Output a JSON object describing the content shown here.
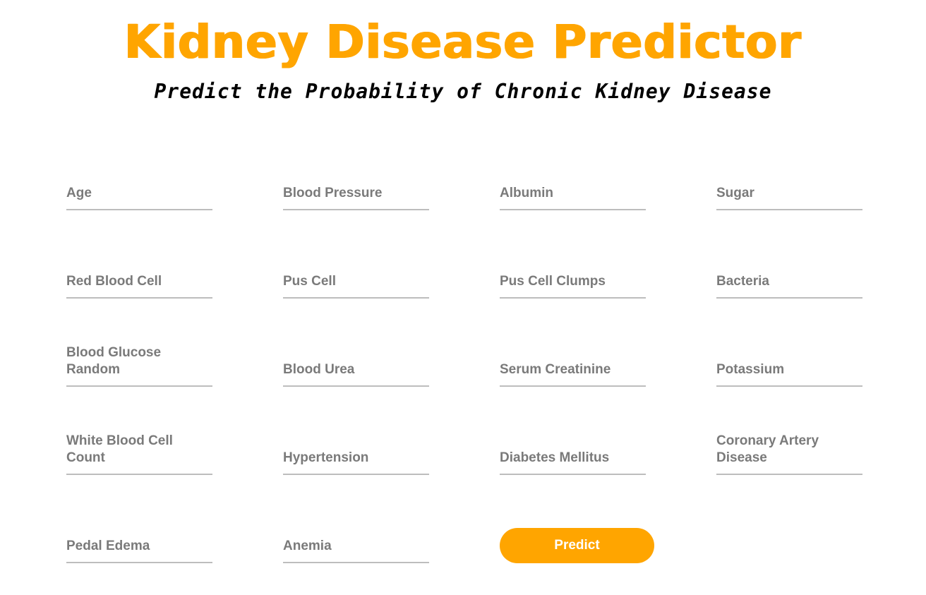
{
  "header": {
    "title": "Kidney Disease Predictor",
    "subtitle": "Predict the Probability of Chronic Kidney Disease"
  },
  "form": {
    "fields": [
      {
        "label": "Age"
      },
      {
        "label": "Blood Pressure"
      },
      {
        "label": "Albumin"
      },
      {
        "label": "Sugar"
      },
      {
        "label": "Red Blood Cell"
      },
      {
        "label": "Pus Cell"
      },
      {
        "label": "Pus Cell Clumps"
      },
      {
        "label": "Bacteria"
      },
      {
        "label": "Blood Glucose Random"
      },
      {
        "label": "Blood Urea"
      },
      {
        "label": "Serum Creatinine"
      },
      {
        "label": "Potassium"
      },
      {
        "label": "White Blood Cell Count"
      },
      {
        "label": "Hypertension"
      },
      {
        "label": "Diabetes Mellitus"
      },
      {
        "label": "Coronary Artery Disease"
      },
      {
        "label": "Pedal Edema"
      },
      {
        "label": "Anemia"
      }
    ],
    "submit_label": "Predict"
  },
  "colors": {
    "accent": "#ffa500",
    "label_text": "#7a7a7a",
    "underline": "#bdbdbd",
    "subtitle_text": "#000000"
  }
}
